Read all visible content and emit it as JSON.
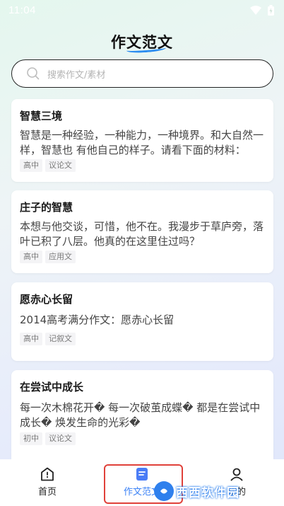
{
  "status_bar": {
    "time": "11:04"
  },
  "header": {
    "title": "作文范文"
  },
  "search": {
    "placeholder": "搜索作文/素材"
  },
  "cards": [
    {
      "title": "智慧三境",
      "excerpt": "智慧是一种经验，一种能力，一种境界。和大自然一样，智慧也 有他自己的样子。请看下面的材料：",
      "tags": [
        "高中",
        "议论文"
      ]
    },
    {
      "title": "庄子的智慧",
      "excerpt": "本想与他交谈，可惜，他不在。我漫步于草庐旁，落叶已积了八层。他真的在这里住过吗？",
      "tags": [
        "高中",
        "应用文"
      ]
    },
    {
      "title": "愿赤心长留",
      "excerpt": "2014高考满分作文：愿赤心长留",
      "tags": [
        "高中",
        "记叙文"
      ]
    },
    {
      "title": "在尝试中成长",
      "excerpt": "每一次木棉花开� 每一次破茧成蝶� 都是在尝试中成长� 焕发生命的光彩�",
      "tags": [
        "初中",
        "议论文"
      ]
    }
  ],
  "bottom_nav": {
    "items": [
      {
        "label": "首页",
        "icon": "home-icon"
      },
      {
        "label": "作文范文",
        "icon": "document-icon"
      },
      {
        "label": "我的",
        "icon": "profile-icon"
      }
    ]
  },
  "watermark": {
    "text": "西西软件园"
  },
  "colors": {
    "accent": "#3b82f6",
    "highlight": "#e0413a"
  }
}
